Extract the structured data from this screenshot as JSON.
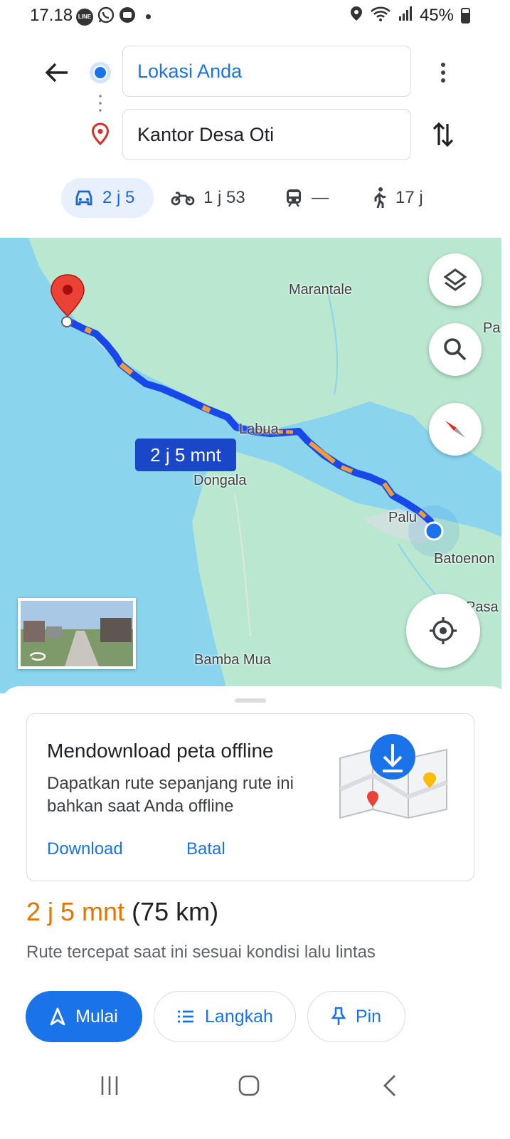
{
  "status_bar": {
    "time": "17.18",
    "app_icons": [
      "line-icon",
      "whatsapp-icon",
      "chat-icon"
    ],
    "line_badge": "LINE",
    "battery": "45%"
  },
  "directions": {
    "origin": "Lokasi Anda",
    "destination": "Kantor Desa Oti"
  },
  "modes": [
    {
      "name": "car",
      "label": "2 j 5",
      "selected": true
    },
    {
      "name": "motorcycle",
      "label": "1 j 53",
      "selected": false
    },
    {
      "name": "transit",
      "label": "—",
      "selected": false
    },
    {
      "name": "walk",
      "label": "17 j",
      "selected": false
    }
  ],
  "map": {
    "labels": {
      "marantale": "Marantale",
      "pa": "Pa",
      "labua": "Labua",
      "dongala": "Dongala",
      "palu": "Palu",
      "batoenon": "Batoenon",
      "pasa": "Pasa",
      "bamba_mua": "Bamba Mua"
    },
    "duration_badge": "2 j 5 mnt",
    "colors": {
      "water": "#8ad4ee",
      "land": "#b9e7d0",
      "route": "#1a47e8",
      "traffic": "#f29b38",
      "destination_pin": "#d93025"
    }
  },
  "offline_card": {
    "title": "Mendownload peta offline",
    "description": "Dapatkan rute sepanjang rute ini bahkan saat Anda offline",
    "download_label": "Download",
    "cancel_label": "Batal"
  },
  "trip": {
    "time": "2 j 5 mnt",
    "distance": "(75 km)",
    "note": "Rute tercepat saat ini sesuai kondisi lalu lintas"
  },
  "actions": {
    "start": "Mulai",
    "steps": "Langkah",
    "pin": "Pin"
  },
  "accent_colors": {
    "primary": "#1a73e8",
    "eta": "#e37400"
  }
}
